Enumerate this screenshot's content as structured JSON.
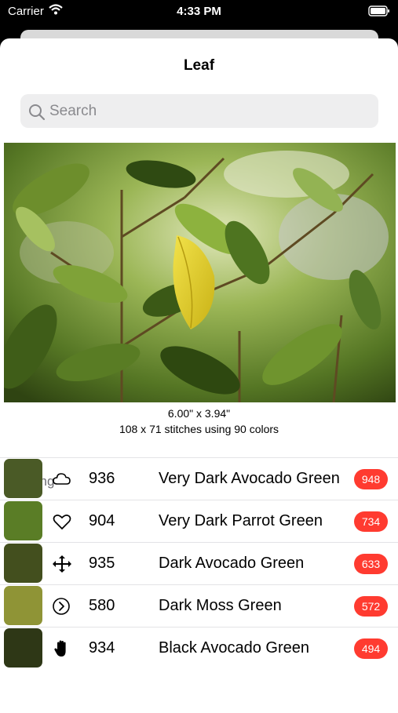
{
  "status_bar": {
    "carrier": "Carrier",
    "time": "4:33 PM"
  },
  "sheet": {
    "title": "Leaf",
    "search_placeholder": "Search",
    "photo_subject": "Leaf",
    "dimensions": "6.00\" x 3.94\"",
    "stitch_info": "108 x 71 stitches using 90 colors"
  },
  "section_header": "Using",
  "colors": [
    {
      "swatch": "#4a5a26",
      "icon": "cloud-icon",
      "code": "936",
      "name": "Very Dark Avocado Green",
      "count": "948"
    },
    {
      "swatch": "#5a7d26",
      "icon": "heart-icon",
      "code": "904",
      "name": "Very Dark Parrot Green",
      "count": "734"
    },
    {
      "swatch": "#434f1e",
      "icon": "move-arrows-icon",
      "code": "935",
      "name": "Dark Avocado Green",
      "count": "633"
    },
    {
      "swatch": "#8f9436",
      "icon": "chevron-right-circle-icon",
      "code": "580",
      "name": "Dark Moss Green",
      "count": "572"
    },
    {
      "swatch": "#2e3716",
      "icon": "hand-icon",
      "code": "934",
      "name": "Black Avocado Green",
      "count": "494"
    }
  ],
  "theme": {
    "badge_color": "#ff3b30",
    "accent": "#000000"
  }
}
